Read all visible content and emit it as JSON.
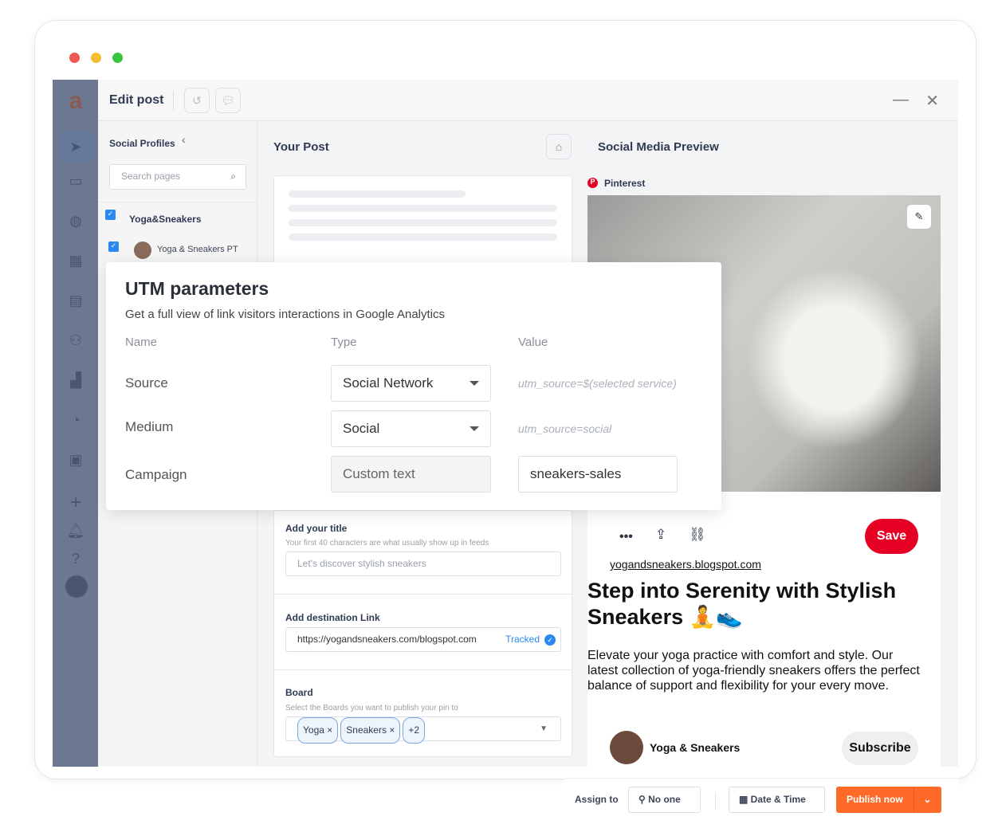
{
  "header": {
    "title": "Edit post"
  },
  "profiles": {
    "title": "Social Profiles",
    "search_placeholder": "Search pages",
    "group": "Yoga&Sneakers",
    "account": "Yoga & Sneakers PT"
  },
  "post": {
    "title": "Your Post",
    "add_title_label": "Add your title",
    "add_title_hint": "Your first 40 characters are what usually show up in feeds",
    "title_placeholder": "Let's discover stylish sneakers",
    "link_label": "Add destination Link",
    "link_value": "https://yogandsneakers.com/blogspot.com",
    "tracked": "Tracked",
    "board_label": "Board",
    "board_hint": "Select the Boards you want to publish your pin to",
    "boards": [
      "Yoga",
      "Sneakers"
    ],
    "more_boards": "+2"
  },
  "preview": {
    "title": "Social Media Preview",
    "network": "Pinterest",
    "more": "•••",
    "save": "Save",
    "domain": "yogandsneakers.blogspot.com",
    "pin_title": "Step into Serenity with Stylish Sneakers 🧘👟",
    "pin_desc": "Elevate your yoga practice with comfort and style. Our latest collection of yoga-friendly sneakers offers the perfect balance of support and flexibility for your every move.",
    "author": "Yoga & Sneakers",
    "subscribe": "Subscribe"
  },
  "utm": {
    "title": "UTM parameters",
    "description": "Get a full view of link visitors interactions in Google Analytics",
    "columns": [
      "Name",
      "Type",
      "Value"
    ],
    "rows": [
      {
        "name": "Source",
        "type": "Social Network",
        "value": "utm_source=$(selected service)"
      },
      {
        "name": "Medium",
        "type": "Social",
        "value": "utm_source=social"
      },
      {
        "name": "Campaign",
        "type": "Custom text",
        "value": "sneakers-sales"
      }
    ]
  },
  "footer": {
    "assign_label": "Assign to",
    "assignee": "No one",
    "date": "Date & Time",
    "publish": "Publish now"
  },
  "colors": {
    "accent": "#ff6a28",
    "pinterest": "#e60023",
    "sidebar": "#6c7891",
    "check": "#2b88f0"
  }
}
